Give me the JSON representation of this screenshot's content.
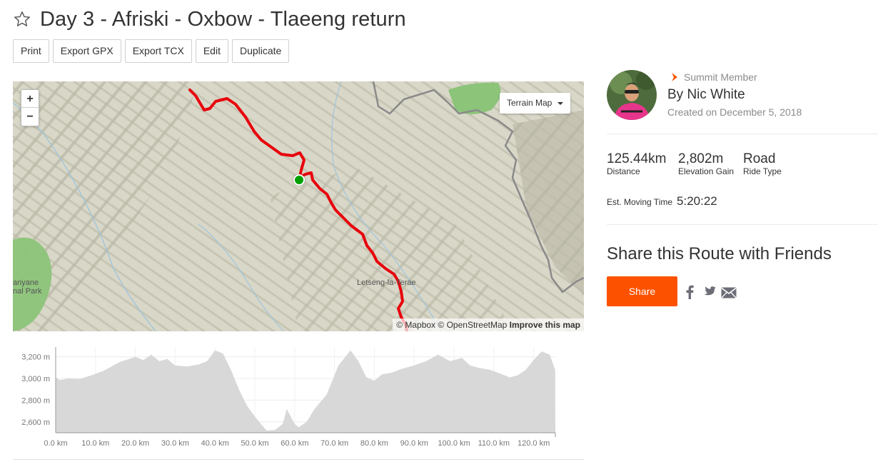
{
  "page": {
    "title": "Day 3 - Afriski - Oxbow - Tlaeeng return",
    "star_icon": "star-outline-icon"
  },
  "toolbar": {
    "buttons": [
      "Print",
      "Export GPX",
      "Export TCX",
      "Edit",
      "Duplicate"
    ]
  },
  "map": {
    "zoom_in": "+",
    "zoom_out": "−",
    "style_label": "Terrain Map",
    "attribution_mapbox": "© Mapbox",
    "attribution_osm": "© OpenStreetMap",
    "attribution_improve": "Improve this map",
    "place_label_1": "Letseng-la-Terae",
    "place_label_2a": "anyane",
    "place_label_2b": "nal Park",
    "route_color": "#e8000b",
    "start_marker_color": "#00a000"
  },
  "elevation": {
    "y_ticks": [
      "3,200 m",
      "3,000 m",
      "2,800 m",
      "2,600 m"
    ],
    "x_ticks": [
      "0.0 km",
      "10.0 km",
      "20.0 km",
      "30.0 km",
      "40.0 km",
      "50.0 km",
      "60.0 km",
      "70.0 km",
      "80.0 km",
      "90.0 km",
      "100.0 km",
      "110.0 km",
      "120.0 km"
    ],
    "fill_color": "#d8d8d8",
    "profile_km": [
      0,
      1,
      3,
      6,
      9,
      12,
      16,
      20,
      22,
      24,
      26,
      28,
      30,
      33,
      36,
      38,
      40,
      42,
      44,
      46,
      48,
      50,
      52,
      53,
      55,
      57,
      58,
      60,
      61,
      63,
      65,
      68,
      71,
      74,
      76,
      78,
      80,
      82,
      84,
      87,
      90,
      93,
      96,
      99,
      102,
      104,
      106,
      109,
      112,
      114,
      116,
      118,
      120,
      122,
      124,
      125.4
    ],
    "profile_m": [
      3010,
      2985,
      3000,
      2995,
      3030,
      3070,
      3150,
      3200,
      3170,
      3220,
      3160,
      3180,
      3120,
      3110,
      3130,
      3160,
      3260,
      3230,
      3080,
      2900,
      2750,
      2650,
      2560,
      2520,
      2525,
      2580,
      2720,
      2580,
      2550,
      2600,
      2720,
      2850,
      3120,
      3260,
      3160,
      3010,
      2980,
      3040,
      3050,
      3090,
      3120,
      3160,
      3220,
      3160,
      3190,
      3120,
      3100,
      3080,
      3040,
      3010,
      3030,
      3080,
      3170,
      3250,
      3220,
      3080
    ]
  },
  "sidebar": {
    "member_label": "Summit Member",
    "member_icon": "summit-chevron-icon",
    "author": "By Nic White",
    "created": "Created on December 5, 2018",
    "stats": [
      {
        "value": "125.44km",
        "label": "Distance"
      },
      {
        "value": "2,802m",
        "label": "Elevation Gain"
      },
      {
        "value": "Road",
        "label": "Ride Type"
      }
    ],
    "moving_time_label": "Est. Moving Time",
    "moving_time_value": "5:20:22",
    "share_heading": "Share this Route with Friends",
    "share_button": "Share",
    "accent": "#fc5200"
  }
}
